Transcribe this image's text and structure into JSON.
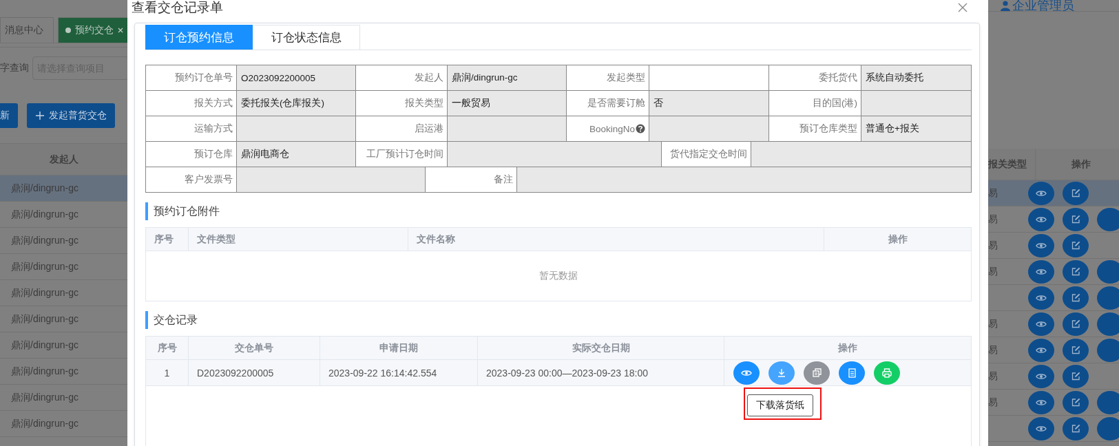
{
  "background": {
    "tabs": [
      {
        "label": "消息中心",
        "selected": false
      },
      {
        "label": "预约交仓",
        "selected": true
      }
    ],
    "user": "企业管理员",
    "search": {
      "label": "字查询",
      "placeholder": "请选择查询项目"
    },
    "buttons": [
      {
        "label": "新",
        "kind": "plain"
      },
      {
        "label": "发起普货交仓",
        "kind": "add"
      }
    ],
    "table": {
      "columns": [
        "发起人",
        "报关类型",
        "操作"
      ],
      "rows": [
        {
          "initiator": "鼎润/dingrun-gc",
          "customs_type": "易",
          "selected": true,
          "extra_button": false
        },
        {
          "initiator": "鼎润/dingrun-gc",
          "customs_type": "易",
          "selected": false,
          "extra_button": true
        },
        {
          "initiator": "鼎润/dingrun-gc",
          "customs_type": "易",
          "selected": false,
          "extra_button": false
        },
        {
          "initiator": "鼎润/dingrun-gc",
          "customs_type": "易",
          "selected": false,
          "extra_button": true
        },
        {
          "initiator": "鼎润/dingrun-gc",
          "selected": false,
          "extra_button": true
        },
        {
          "initiator": "鼎润/dingrun-gc",
          "customs_type": "易",
          "selected": false,
          "extra_button": true
        },
        {
          "initiator": "鼎润/dingrun-gc",
          "customs_type": "易",
          "selected": false,
          "extra_button": true
        },
        {
          "initiator": "鼎润/dingrun-gc",
          "customs_type": "易",
          "selected": false,
          "extra_button": false
        },
        {
          "initiator": "鼎润/dingrun-gc",
          "customs_type": "易",
          "selected": false,
          "extra_button": true
        },
        {
          "initiator": "鼎润/dingrun-gc",
          "selected": false,
          "extra_button": true
        }
      ]
    }
  },
  "dialog": {
    "title": "查看交仓记录单",
    "tabs": [
      {
        "label": "订仓预约信息",
        "selected": true
      },
      {
        "label": "订仓状态信息",
        "selected": false
      }
    ],
    "info_rows": [
      {
        "kind": "quad",
        "cells": [
          {
            "label": "预约订仓单号",
            "value": "O2023092200005",
            "shaded": true,
            "help": false
          },
          {
            "label": "发起人",
            "value": "鼎润/dingrun-gc",
            "shaded": true,
            "help": false
          },
          {
            "label": "发起类型",
            "shaded": false,
            "help": false
          },
          {
            "label": "委托货代",
            "value": "系统自动委托",
            "shaded": true,
            "help": false
          }
        ]
      },
      {
        "kind": "quad",
        "cells": [
          {
            "label": "报关方式",
            "value": "委托报关(仓库报关)",
            "shaded": true,
            "help": false
          },
          {
            "label": "报关类型",
            "value": "一般贸易",
            "shaded": true,
            "help": false
          },
          {
            "label": "是否需要订舱",
            "value": "否",
            "shaded": true,
            "help": false
          },
          {
            "label": "目的国(港)",
            "shaded": true,
            "help": false
          }
        ]
      },
      {
        "kind": "quad",
        "cells": [
          {
            "label": "运输方式",
            "shaded": true,
            "help": false
          },
          {
            "label": "启运港",
            "shaded": true,
            "help": false
          },
          {
            "label": "BookingNo",
            "shaded": true,
            "help": true
          },
          {
            "label": "预订仓库类型",
            "value": "普通仓+报关",
            "shaded": true,
            "help": false
          }
        ]
      },
      {
        "kind": "triple",
        "cells": [
          {
            "label": "预订仓库",
            "value": "鼎润电商仓",
            "shaded": true,
            "help": false
          },
          {
            "label": "工厂预计订仓时间",
            "shaded": true,
            "help": false
          },
          {
            "label": "货代指定交仓时间",
            "shaded": true,
            "help": false
          }
        ]
      },
      {
        "kind": "pair",
        "cells": [
          {
            "label": "客户发票号",
            "shaded": true,
            "help": false
          },
          {
            "label": "备注",
            "shaded": true,
            "help": false
          }
        ]
      }
    ],
    "attachments": {
      "title": "预约订仓附件",
      "columns": [
        "序号",
        "文件类型",
        "文件名称",
        "操作"
      ],
      "empty_text": "暂无数据"
    },
    "records": {
      "title": "交仓记录",
      "columns": [
        "序号",
        "交仓单号",
        "申请日期",
        "实际交仓日期",
        "操作"
      ],
      "rows": [
        {
          "index": "1",
          "number": "D2023092200005",
          "applied": "2023-09-22 16:14:42.554",
          "actual": "2023-09-23 00:00—2023-09-23 18:00",
          "actions": [
            {
              "kind": "view",
              "hovered": false
            },
            {
              "kind": "download",
              "hovered": true
            },
            {
              "kind": "copy",
              "hovered": false
            },
            {
              "kind": "document",
              "hovered": false
            },
            {
              "kind": "print",
              "hovered": false
            }
          ]
        }
      ]
    },
    "tooltip": {
      "text": "下载落货纸",
      "highlighted": true
    }
  }
}
